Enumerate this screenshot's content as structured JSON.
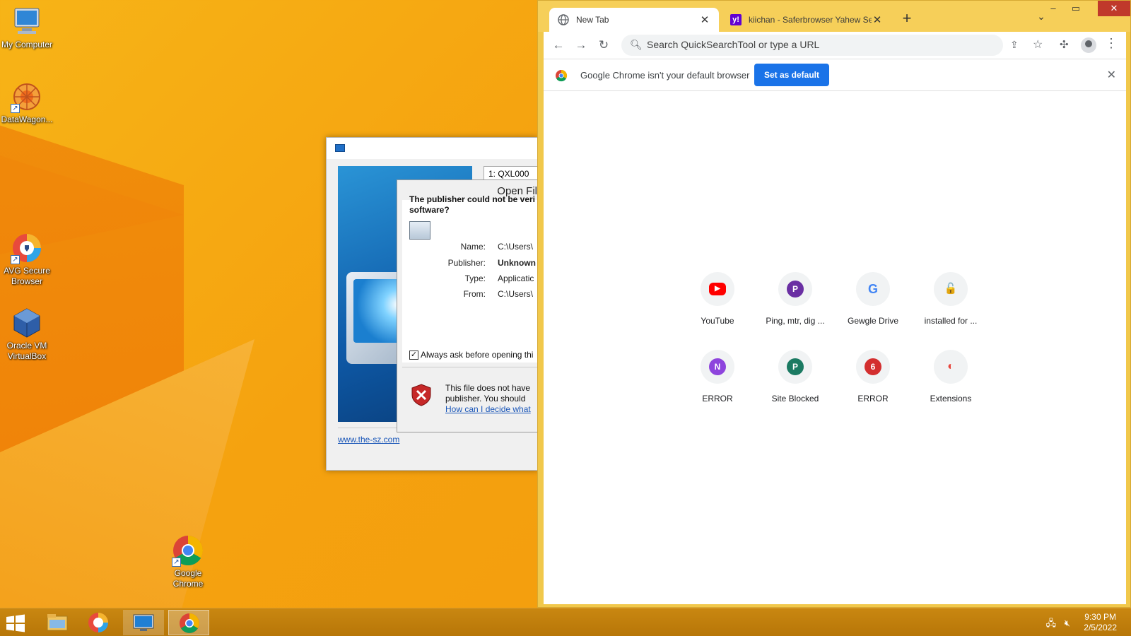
{
  "desktop": {
    "icons": [
      {
        "label": "My Computer"
      },
      {
        "label": "DataWagon..."
      },
      {
        "label": "AVG Secure Browser"
      },
      {
        "label": "Oracle VM VirtualBox"
      },
      {
        "label": "Google Chrome"
      }
    ]
  },
  "vb_window": {
    "tab_label": "1: QXL000",
    "link": "www.the-sz.com"
  },
  "open_file": {
    "title": "Open Fil",
    "heading": "The publisher could not be veri software?",
    "heading_line1": "The publisher could not be veri",
    "heading_line2": "software?",
    "rows": [
      {
        "label": "Name:",
        "value": "C:\\Users\\"
      },
      {
        "label": "Publisher:",
        "value": "Unknown"
      },
      {
        "label": "Type:",
        "value": "Applicatic"
      },
      {
        "label": "From:",
        "value": "C:\\Users\\"
      }
    ],
    "checkbox_label": "Always ask before opening thi",
    "warn_line1": "This file does not have",
    "warn_line2": "publisher.  You should",
    "warn_link": "How can I decide what"
  },
  "chrome": {
    "tabs": [
      {
        "title": "New Tab"
      },
      {
        "title": "kiichan - Saferbrowser Yahew Sea"
      }
    ],
    "omnibox_placeholder": "Search QuickSearchTool or type a URL",
    "infobar": {
      "message": "Google Chrome isn't your default browser",
      "button": "Set as default"
    },
    "shortcuts": [
      {
        "label": "YouTube",
        "letter": "▶",
        "color": "#ff0000"
      },
      {
        "label": "Ping, mtr, dig ...",
        "letter": "P",
        "color": "#6a2fa3"
      },
      {
        "label": "Gewgle Drive",
        "letter": "G",
        "color": "#4285f4"
      },
      {
        "label": "installed for ...",
        "letter": "🔓",
        "color": "#e53935"
      },
      {
        "label": "ERROR",
        "letter": "N",
        "color": "#8e44dd"
      },
      {
        "label": "Site Blocked",
        "letter": "P",
        "color": "#1b7a62"
      },
      {
        "label": "ERROR",
        "letter": "6",
        "color": "#d32f2f"
      },
      {
        "label": "Extensions",
        "letter": "◐",
        "color": "#e8453c"
      }
    ]
  },
  "taskbar": {
    "time": "9:30 PM",
    "date": "2/5/2022"
  }
}
